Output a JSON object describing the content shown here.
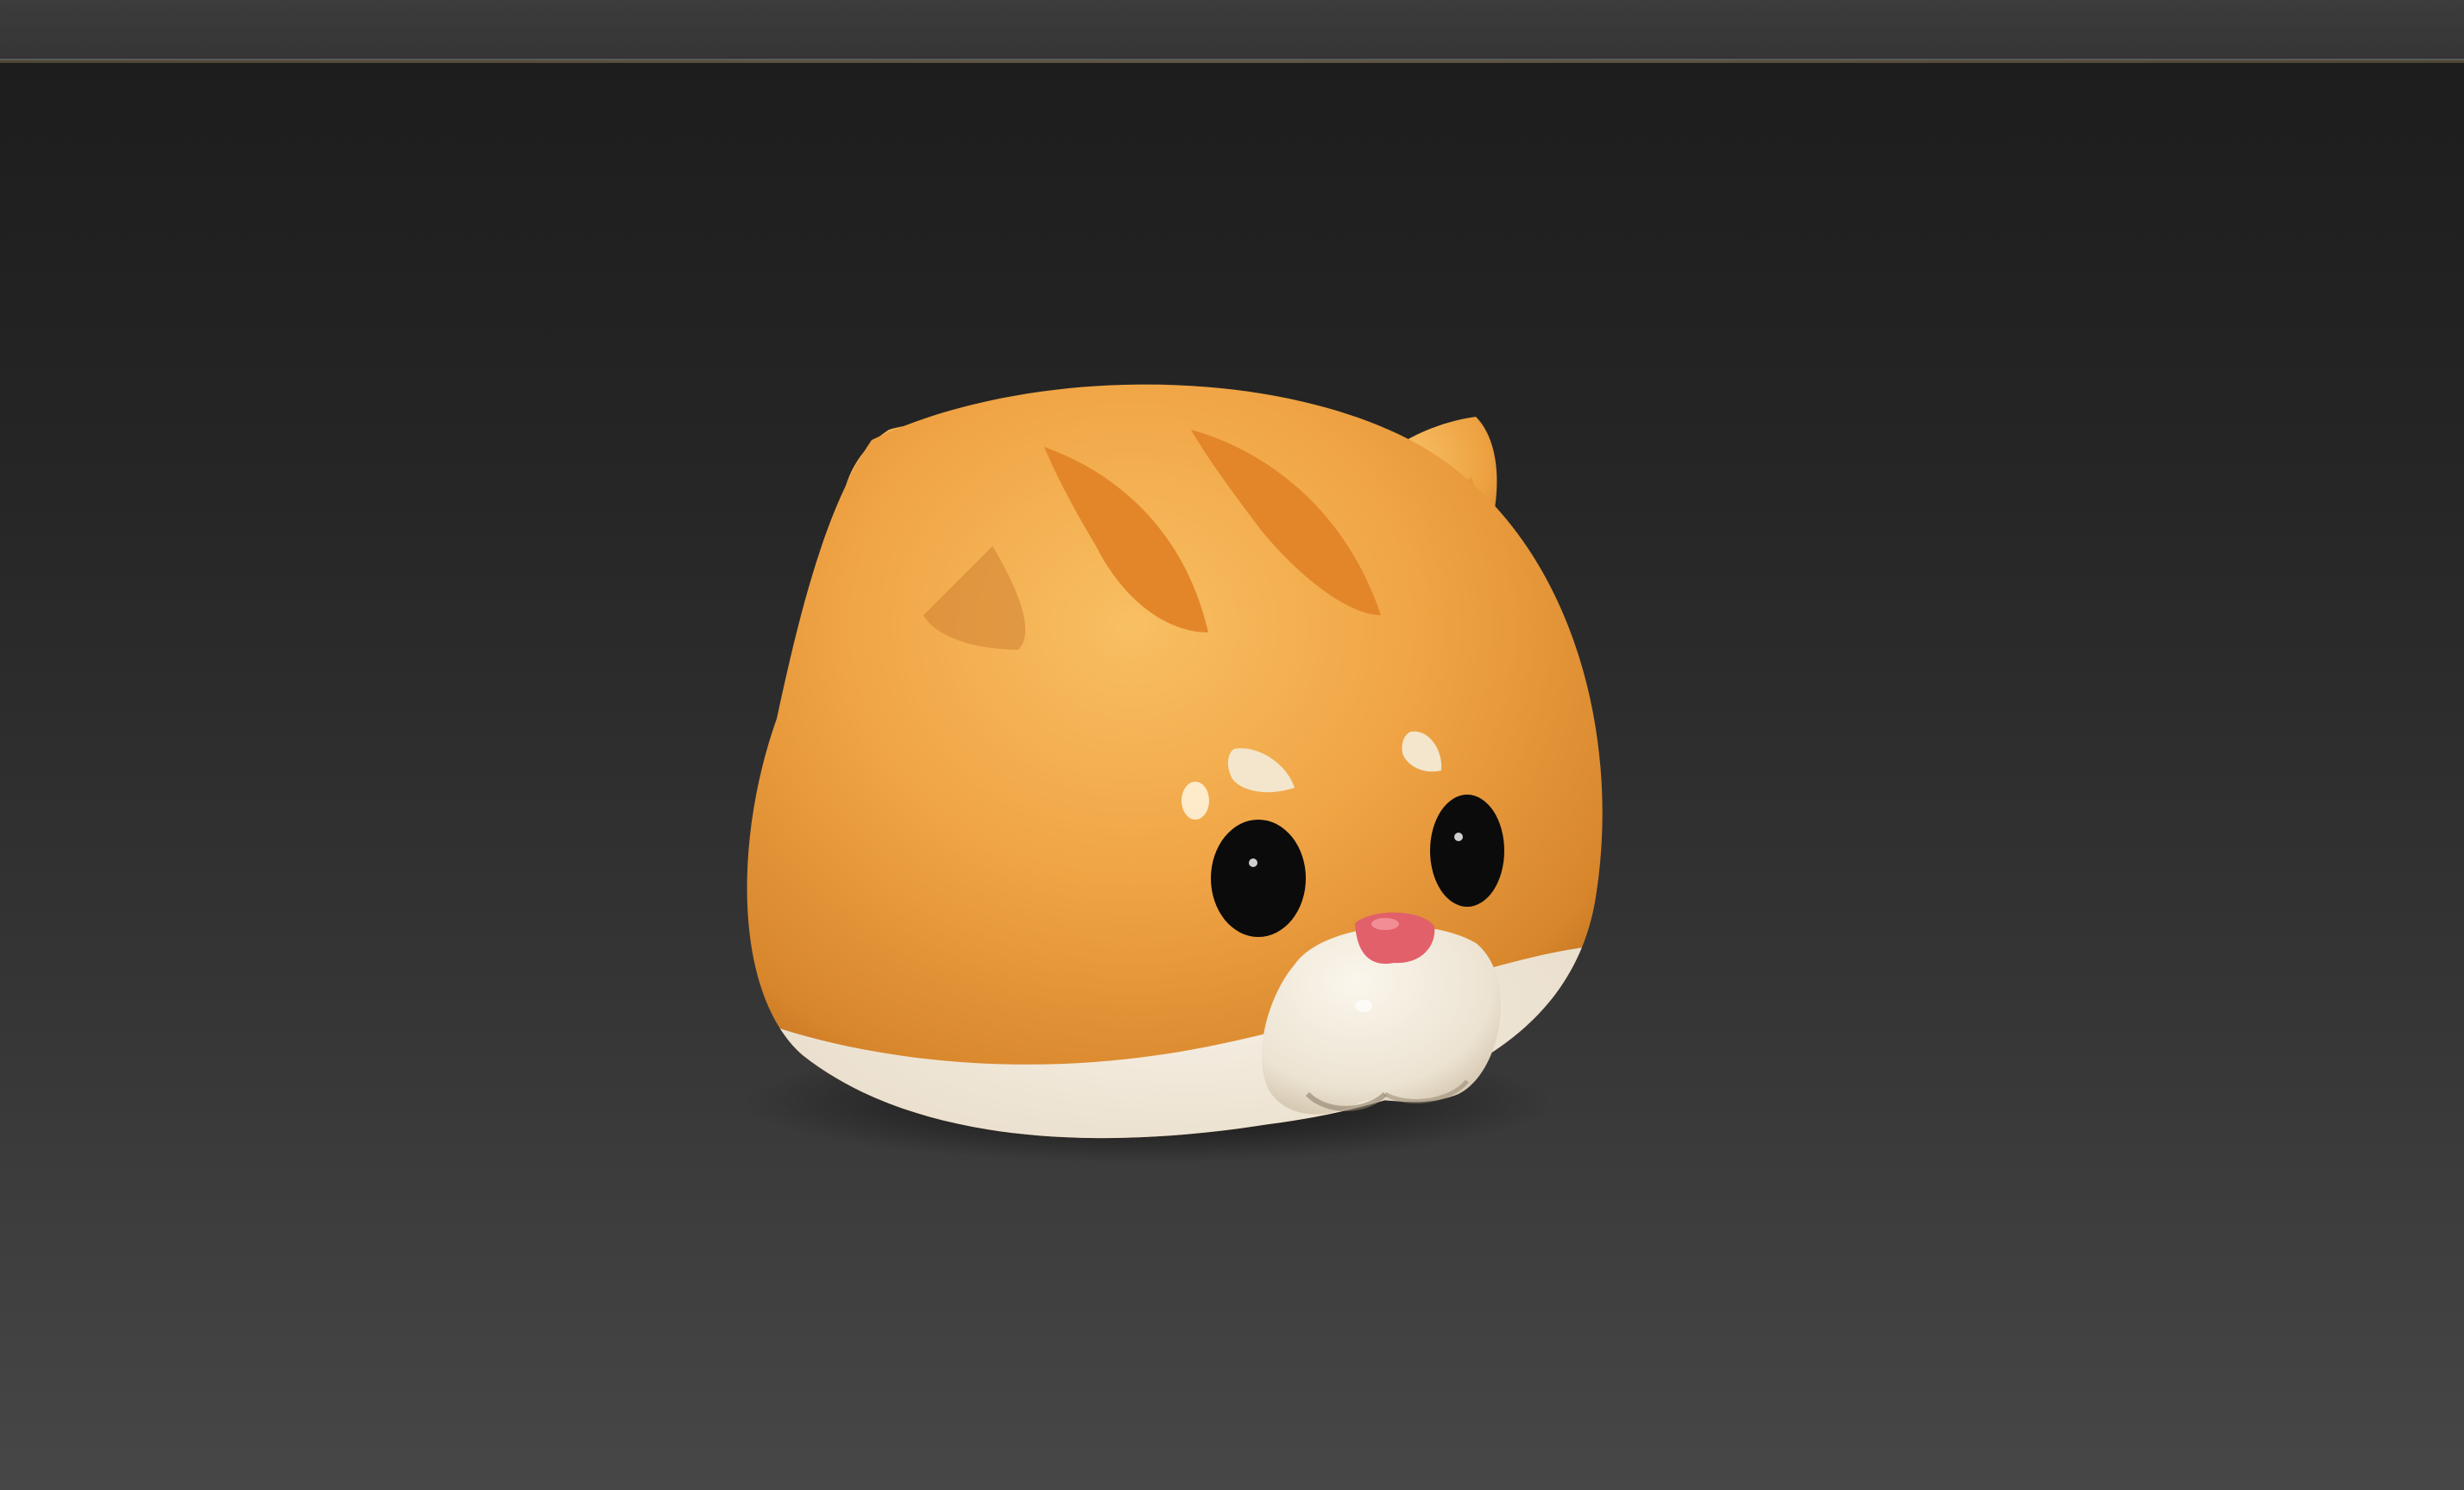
{
  "viewport": {
    "model": "cat-head",
    "colors": {
      "background_top": "#1d1d1d",
      "background_bottom": "#474747",
      "fur_orange": "#f0a445",
      "fur_light": "#f6bb5e",
      "stripe": "#e3862a",
      "muzzle_cream": "#efe7d8",
      "ear_inner_pink": "#d98a95",
      "nose_pink": "#e2606a",
      "eye_black": "#0b0b0b"
    }
  }
}
